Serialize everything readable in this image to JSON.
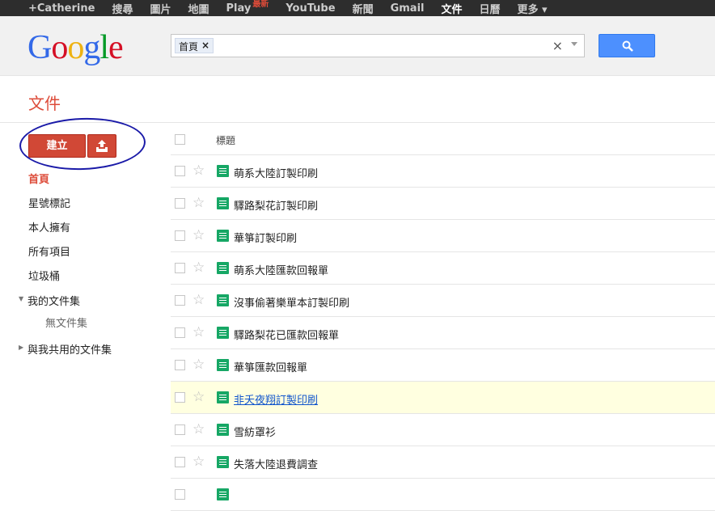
{
  "topbar": {
    "items": [
      {
        "label": "+Catherine"
      },
      {
        "label": "搜尋"
      },
      {
        "label": "圖片"
      },
      {
        "label": "地圖"
      },
      {
        "label": "Play",
        "badge": "最新"
      },
      {
        "label": "YouTube"
      },
      {
        "label": "新聞"
      },
      {
        "label": "Gmail"
      },
      {
        "label": "文件",
        "active": true
      },
      {
        "label": "日曆"
      },
      {
        "label": "更多 ▾"
      }
    ]
  },
  "logo": "Google",
  "search": {
    "chip": "首頁",
    "chip_close": "×",
    "clear": "×"
  },
  "app_title": "文件",
  "create_label": "建立",
  "sidebar": {
    "items": [
      "首頁",
      "星號標記",
      "本人擁有",
      "所有項目",
      "垃圾桶"
    ],
    "my_collections": "我的文件集",
    "no_collections": "無文件集",
    "shared_collections": "與我共用的文件集"
  },
  "list": {
    "column_title": "標題",
    "files": [
      "萌系大陸訂製印刷",
      "驛路梨花訂製印刷",
      "華箏訂製印刷",
      "萌系大陸匯款回報單",
      "沒事偷著樂單本訂製印刷",
      "驛路梨花已匯款回報單",
      "華箏匯款回報單",
      "非夭夜翔訂製印刷",
      "雪紡罩衫",
      "失落大陸退費調查"
    ],
    "highlighted_index": 7
  },
  "colors": {
    "accent": "#dd4b39",
    "create": "#d14836",
    "search": "#4d90fe",
    "form_icon": "#16a765",
    "highlight": "#ffffe0"
  }
}
